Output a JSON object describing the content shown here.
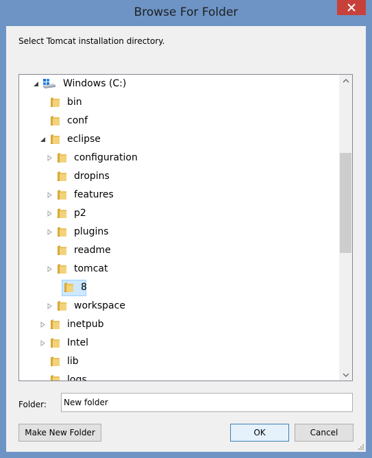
{
  "window": {
    "title": "Browse For Folder",
    "close_glyph": "×"
  },
  "prompt": "Select Tomcat installation directory.",
  "tree": [
    {
      "label": "Windows (C:)",
      "level": 0,
      "arrow": "expanded",
      "icon": "drive-icon"
    },
    {
      "label": "bin",
      "level": 1,
      "arrow": "none",
      "icon": "folder-icon"
    },
    {
      "label": "conf",
      "level": 1,
      "arrow": "none",
      "icon": "folder-icon"
    },
    {
      "label": "eclipse",
      "level": 1,
      "arrow": "expanded",
      "icon": "folder-icon"
    },
    {
      "label": "configuration",
      "level": 2,
      "arrow": "collapsed",
      "icon": "folder-icon"
    },
    {
      "label": "dropins",
      "level": 2,
      "arrow": "none",
      "icon": "folder-icon"
    },
    {
      "label": "features",
      "level": 2,
      "arrow": "collapsed",
      "icon": "folder-icon"
    },
    {
      "label": "p2",
      "level": 2,
      "arrow": "collapsed",
      "icon": "folder-icon"
    },
    {
      "label": "plugins",
      "level": 2,
      "arrow": "collapsed",
      "icon": "folder-icon"
    },
    {
      "label": "readme",
      "level": 2,
      "arrow": "none",
      "icon": "folder-icon"
    },
    {
      "label": "tomcat",
      "level": 2,
      "arrow": "collapsed",
      "icon": "folder-icon"
    },
    {
      "label": "8",
      "level": 3,
      "arrow": "none",
      "icon": "folder-icon",
      "selected": true
    },
    {
      "label": "workspace",
      "level": 2,
      "arrow": "collapsed",
      "icon": "folder-icon"
    },
    {
      "label": "inetpub",
      "level": 1,
      "arrow": "collapsed",
      "icon": "folder-icon"
    },
    {
      "label": "Intel",
      "level": 1,
      "arrow": "collapsed",
      "icon": "folder-icon"
    },
    {
      "label": "lib",
      "level": 1,
      "arrow": "none",
      "icon": "folder-icon"
    },
    {
      "label": "logs",
      "level": 1,
      "arrow": "none",
      "icon": "folder-icon"
    }
  ],
  "folder_field": {
    "label": "Folder:",
    "value": "New folder"
  },
  "buttons": {
    "make_new_folder": "Make New Folder",
    "ok": "OK",
    "cancel": "Cancel"
  },
  "colors": {
    "frame": "#6d94c5",
    "close": "#c7413a",
    "selection": "#cde8ff",
    "folder": "#e8c25a"
  }
}
